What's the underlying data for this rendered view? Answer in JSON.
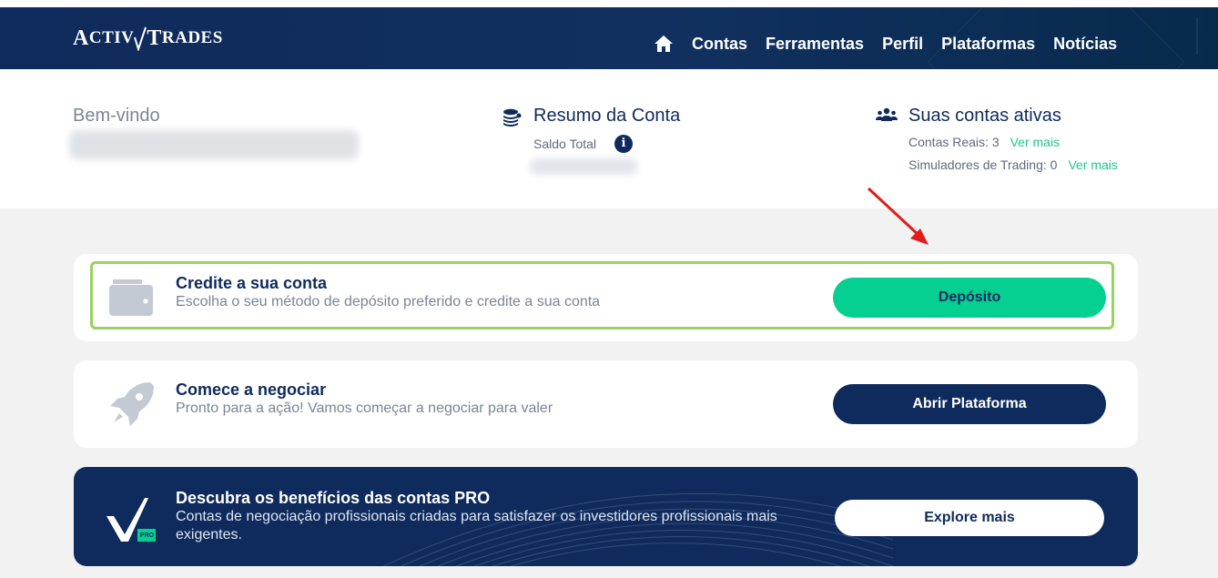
{
  "header": {
    "logo": {
      "part1_big": "A",
      "part1_small": "CTIV",
      "part2_big": "T",
      "part2_small": "RADES"
    },
    "nav": [
      "Contas",
      "Ferramentas",
      "Perfil",
      "Plataformas",
      "Notícias"
    ],
    "icons": {
      "home": "home-icon"
    }
  },
  "summary": {
    "welcome": "Bem-vindo",
    "account_summary": {
      "title": "Resumo da Conta",
      "balance_label": "Saldo Total",
      "info_glyph": "i"
    },
    "active_accounts": {
      "title": "Suas contas ativas",
      "real_label": "Contas Reais: 3",
      "sim_label": "Simuladores de Trading: 0",
      "link": "Ver mais"
    }
  },
  "cards": {
    "deposit": {
      "title": "Credite a sua conta",
      "description": "Escolha o seu método de depósito preferido e credite a sua conta",
      "button": "Depósito"
    },
    "trade": {
      "title": "Comece a negociar",
      "description": "Pronto para a ação! Vamos começar a negociar para valer",
      "button": "Abrir Plataforma"
    },
    "pro": {
      "title": "Descubra os benefícios das contas PRO",
      "description": "Contas de negociação profissionais criadas para satisfazer os investidores profissionais mais exigentes.",
      "badge": "PRO",
      "button": "Explore mais"
    }
  },
  "colors": {
    "navy": "#0f2a5c",
    "accent_green": "#05d092",
    "link_green": "#22c58c",
    "highlight": "#96d35f",
    "annotation_arrow": "#e31b1b"
  }
}
